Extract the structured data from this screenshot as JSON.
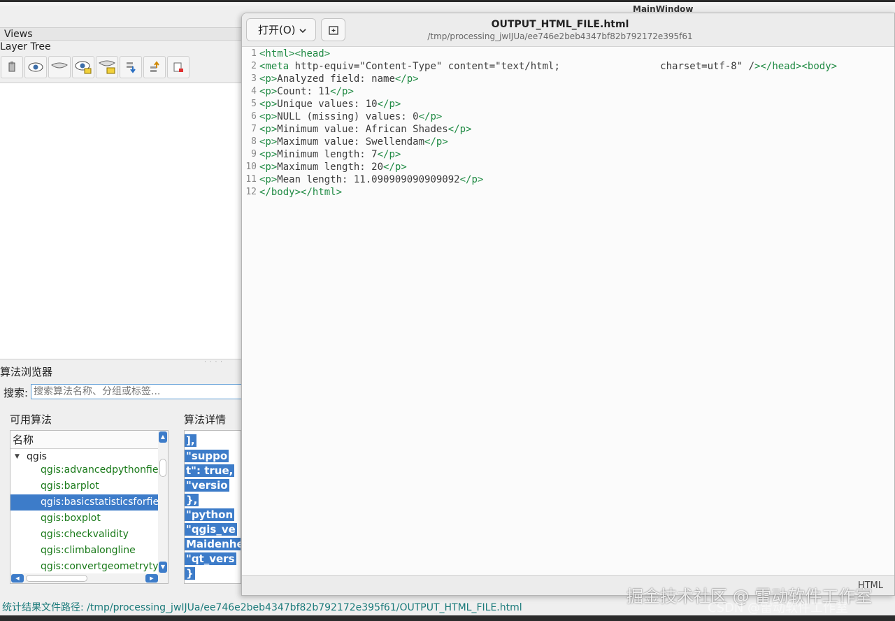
{
  "main_window": {
    "title": "MainWindow",
    "views_label": "Views",
    "layer_tree_label": "Layer Tree",
    "toolbar_icons": [
      "open-layer-styling-icon",
      "eye-icon",
      "collapse-icon",
      "eye-filter-icon",
      "expand-all-icon",
      "move-down-icon",
      "move-up-icon",
      "remove-layer-icon"
    ]
  },
  "algorithm_browser": {
    "title": "算法浏览器",
    "search_label": "搜索:",
    "search_placeholder": "搜索算法名称、分组或标签...",
    "available_label": "可用算法",
    "details_label": "算法详情",
    "list_header": "名称",
    "root": "qgis",
    "items": [
      "qgis:advancedpythonfieldcalculator",
      "qgis:barplot",
      "qgis:basicstatisticsforfields",
      "qgis:boxplot",
      "qgis:checkvalidity",
      "qgis:climbalongline",
      "qgis:convertgeometrytype"
    ],
    "selected_index": 2,
    "details_lines": [
      "   ],",
      "   \"suppo",
      "t\": true,",
      "   \"versio",
      " },",
      " \"python",
      " \"qgis_ve",
      "Maidenhe",
      " \"qt_vers",
      "}"
    ]
  },
  "status_bar": {
    "text": "统计结果文件路径: /tmp/processing_jwIJUa/ee746e2beb4347bf82b792172e395f61/OUTPUT_HTML_FILE.html"
  },
  "editor": {
    "open_label": "打开(O)",
    "file_name": "OUTPUT_HTML_FILE.html",
    "file_path": "/tmp/processing_jwIJUa/ee746e2beb4347bf82b792172e395f61",
    "language": "HTML",
    "lines": [
      "<html><head>",
      "<meta http-equiv=\"Content-Type\" content=\"text/html;                 charset=utf-8\" /></head><body>",
      "<p>Analyzed field: name</p>",
      "<p>Count: 11</p>",
      "<p>Unique values: 10</p>",
      "<p>NULL (missing) values: 0</p>",
      "<p>Minimum value: African Shades</p>",
      "<p>Maximum value: Swellendam</p>",
      "<p>Minimum length: 7</p>",
      "<p>Maximum length: 20</p>",
      "<p>Mean length: 11.090909090909092</p>",
      "</body></html>"
    ]
  },
  "watermark": {
    "line1": "掘金技术社区 @ 雷动软件工作室",
    "line2": "CSDN @雷动软件工作室"
  },
  "colors": {
    "selection": "#3d7cc9",
    "algo_text": "#1a7a1a",
    "tag": "#1f8a43",
    "attr": "#1a5fa8",
    "string": "#b8860b"
  }
}
